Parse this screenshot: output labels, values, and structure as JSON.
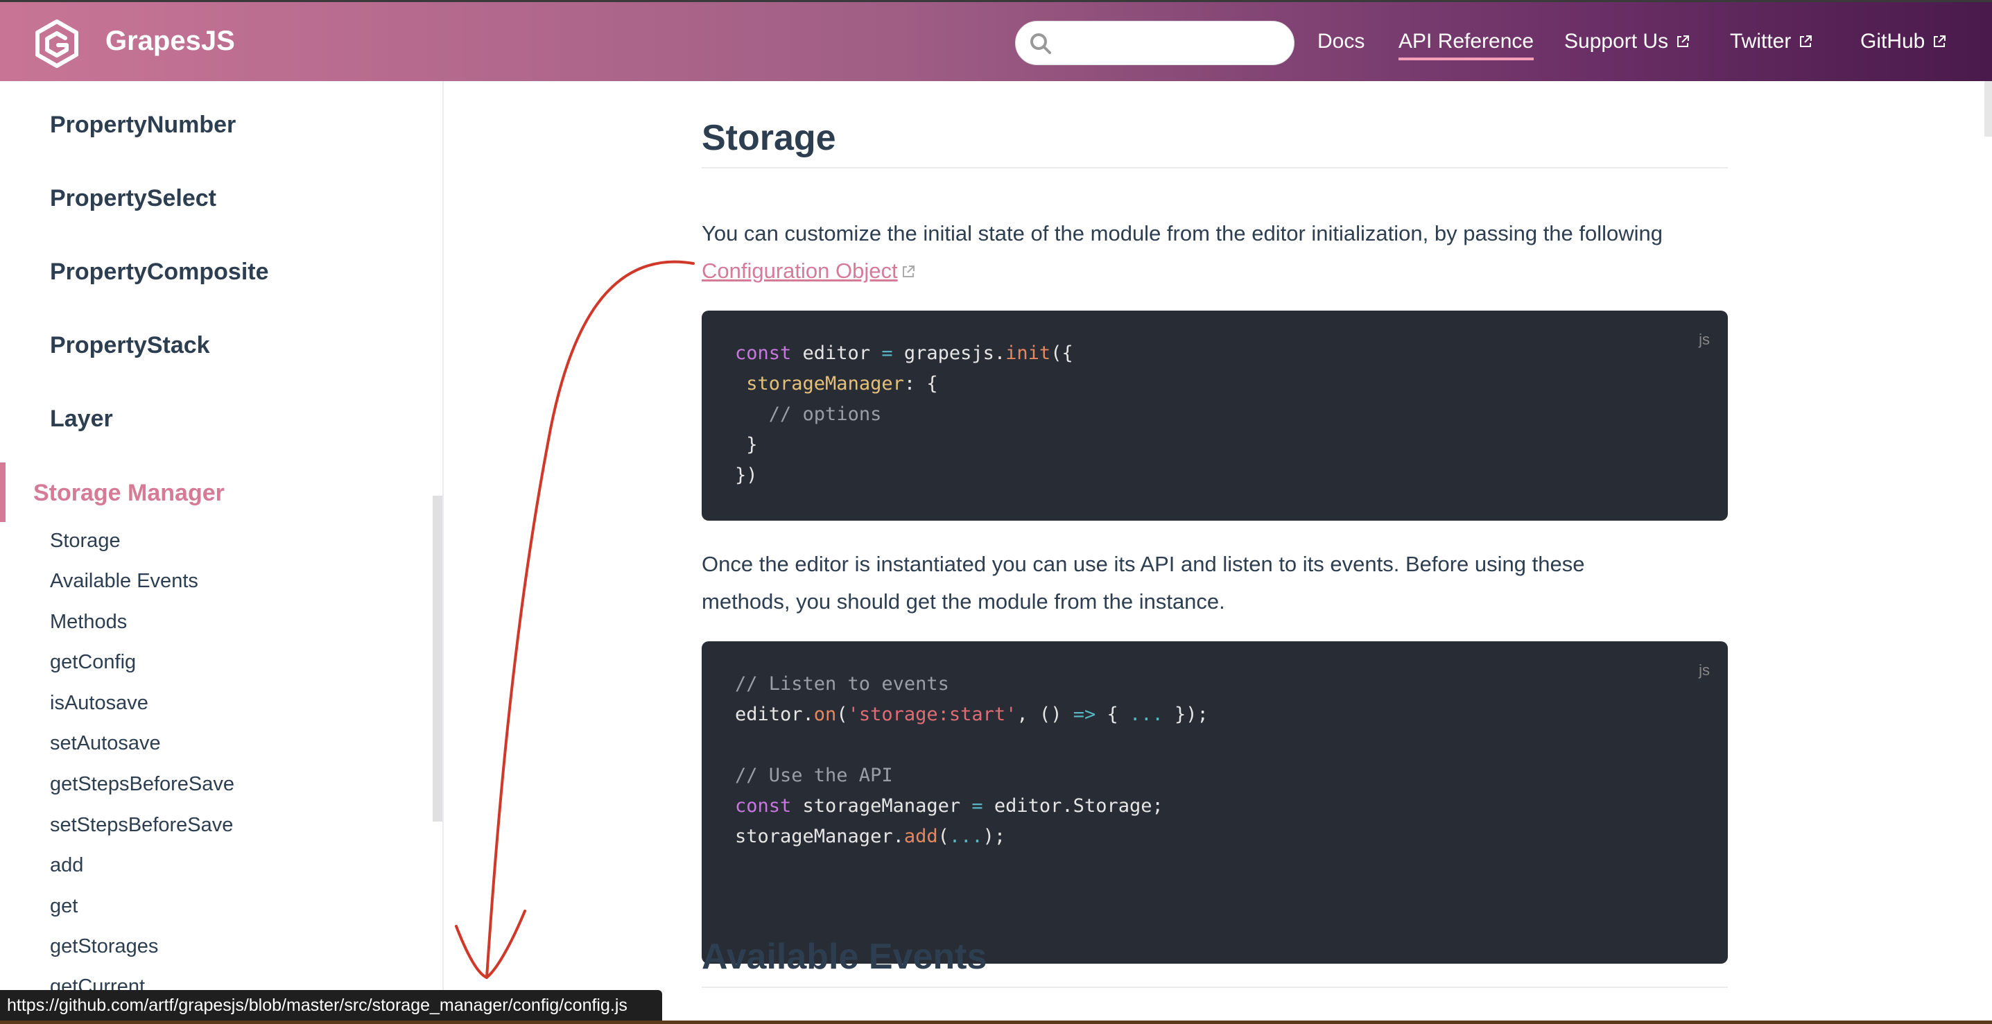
{
  "navbar": {
    "brand": "GrapesJS",
    "search": {
      "placeholder": "",
      "value": ""
    },
    "links": [
      {
        "label": "Docs"
      },
      {
        "label": "API Reference"
      },
      {
        "label": "Support Us"
      },
      {
        "label": "Twitter"
      },
      {
        "label": "GitHub"
      }
    ]
  },
  "sidebar": {
    "headings": [
      "PropertyNumber",
      "PropertySelect",
      "PropertyComposite",
      "PropertyStack",
      "Layer"
    ],
    "active_section": "Storage Manager",
    "items": [
      "Storage",
      "Available Events",
      "Methods",
      "getConfig",
      "isAutosave",
      "setAutosave",
      "getStepsBeforeSave",
      "setStepsBeforeSave",
      "add",
      "get",
      "getStorages",
      "getCurrent"
    ]
  },
  "main": {
    "title": "Storage",
    "intro_text": "You can customize the initial state of the module from the editor initialization, by passing the following",
    "intro_link": "Configuration Object",
    "code1": {
      "lang": "js",
      "l1_kw": "const",
      "l1_var": " editor ",
      "l1_op": "=",
      "l1_obj": " grapesjs.",
      "l1_fn": "init",
      "l1_end": "({",
      "l2_prop": "storageManager",
      "l2_end": ": {",
      "l3_cm": "// options",
      "l4": "}",
      "l5": "})"
    },
    "para2_line1": "Once the editor is instantiated you can use its API and listen to its events. Before using these",
    "para2_line2": "methods, you should get the module from the instance.",
    "code2": {
      "lang": "js",
      "l1_cm": "// Listen to events",
      "l2_obj": "editor.",
      "l2_fn": "on",
      "l2_p": "(",
      "l2_str": "'storage:start'",
      "l2_mid": ", () ",
      "l2_op": "=>",
      "l2_brace": " { ",
      "l2_dots": "...",
      "l2_end": " });",
      "l4_cm": "// Use the API",
      "l5_kw": "const",
      "l5_var": " storageManager ",
      "l5_op": "=",
      "l5_end": " editor.Storage;",
      "l6_obj": "storageManager.",
      "l6_fn": "add",
      "l6_p": "(",
      "l6_dots": "...",
      "l6_end": ");"
    },
    "title2": "Available Events"
  },
  "status_bar": {
    "url": "https://github.com/artf/grapesjs/blob/master/src/storage_manager/config/config.js"
  },
  "colors": {
    "accent": "#d57b98",
    "code_bg": "#282c34",
    "annotation": "#d0382a"
  }
}
